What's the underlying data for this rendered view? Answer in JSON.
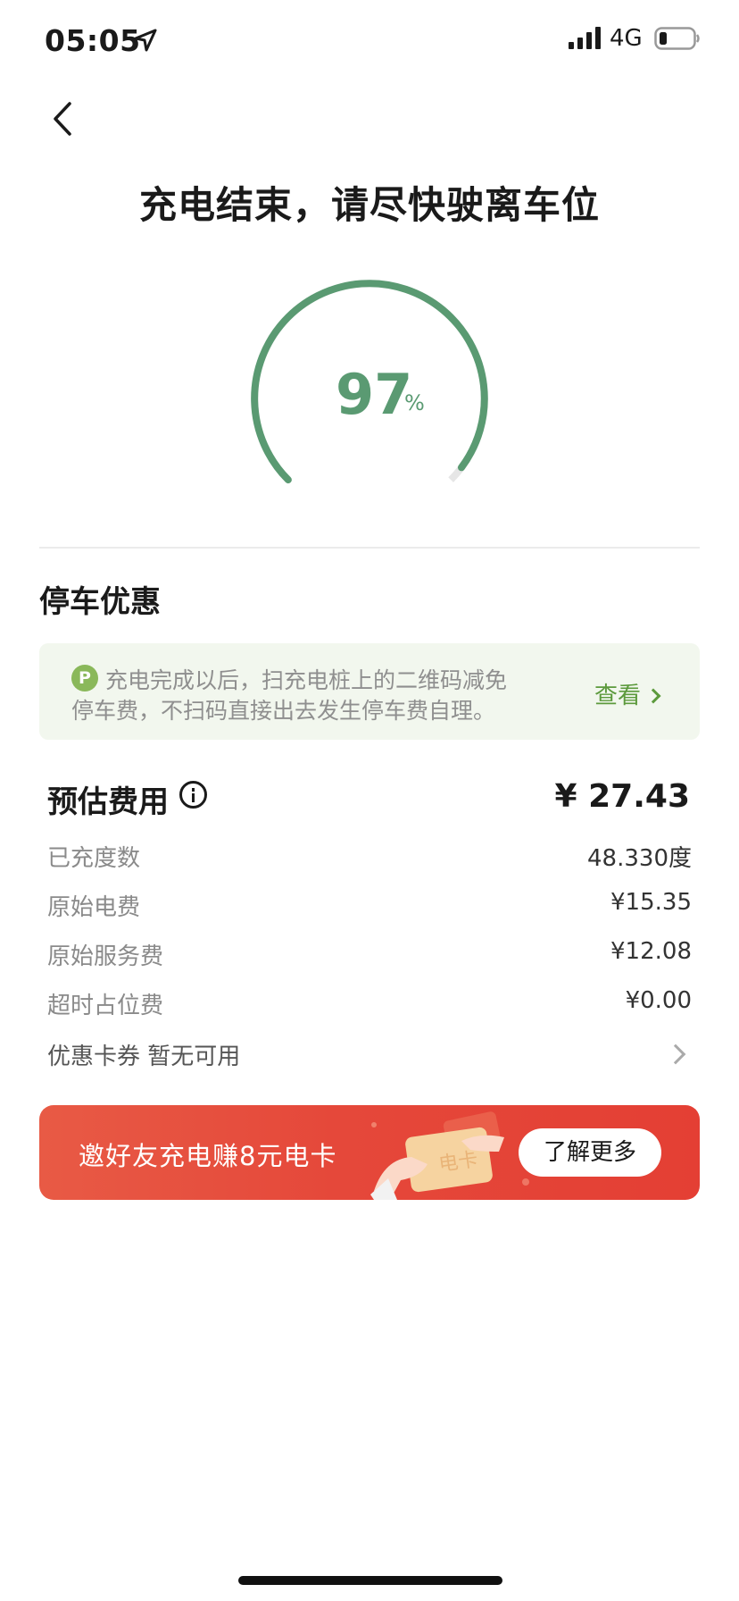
{
  "status_bar": {
    "time": "05:05",
    "network": "4G"
  },
  "page": {
    "title": "充电结束，请尽快驶离车位"
  },
  "gauge": {
    "value": "97",
    "unit": "%",
    "fraction": 0.97
  },
  "parking": {
    "section_title": "停车优惠",
    "icon_letter": "P",
    "notice_line1": "充电完成以后，扫充电桩上的二维码减免",
    "notice_line2": "停车费，不扫码直接出去发生停车费自理。",
    "link_label": "查看"
  },
  "fee": {
    "title": "预估费用",
    "total": "¥ 27.43",
    "rows": [
      {
        "label": "已充度数",
        "value": "48.330度"
      },
      {
        "label": "原始电费",
        "value": "¥15.35"
      },
      {
        "label": "原始服务费",
        "value": "¥12.08"
      },
      {
        "label": "超时占位费",
        "value": "¥0.00"
      }
    ],
    "coupon_label": "优惠卡券 暂无可用"
  },
  "banner": {
    "text": "邀好友充电赚8元电卡",
    "card_text": "电卡",
    "button_label": "了解更多"
  },
  "colors": {
    "accent_green": "#5a9a72",
    "link_green": "#5c9a3c",
    "banner_red": "#e5483a",
    "notice_bg": "#f2f7ee"
  },
  "icons": [
    "location-arrow-icon",
    "signal-icon",
    "battery-icon",
    "back-icon",
    "parking-icon",
    "info-icon",
    "chevron-right-icon"
  ]
}
